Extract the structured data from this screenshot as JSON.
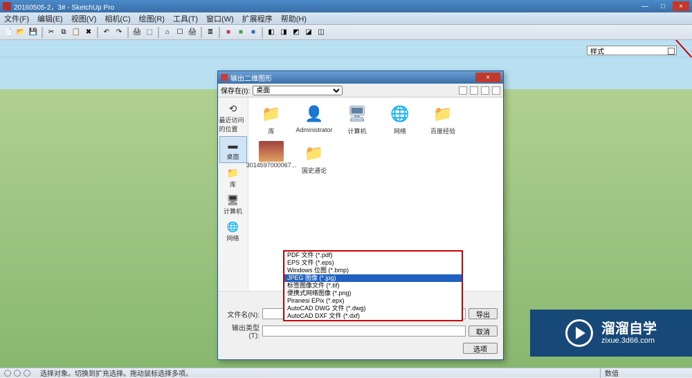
{
  "window": {
    "title": "20160505-2，3# - SketchUp Pro",
    "controls": {
      "min": "—",
      "max": "□",
      "close": "×"
    }
  },
  "menus": [
    "文件(F)",
    "编辑(E)",
    "视图(V)",
    "相机(C)",
    "绘图(R)",
    "工具(T)",
    "窗口(W)",
    "扩展程序",
    "帮助(H)"
  ],
  "toolbar1_icons": [
    "new-icon",
    "open-icon",
    "save-icon",
    "sep",
    "cut-icon",
    "copy-icon",
    "paste-icon",
    "delete-icon",
    "sep",
    "undo-icon",
    "redo-icon",
    "sep",
    "print-icon",
    "model-icon",
    "sep",
    "home-icon",
    "room-icon",
    "print2-icon",
    "sep",
    "layers-icon",
    "sep",
    "rgb1-icon",
    "rgb2-icon",
    "rgb3-icon",
    "sep",
    "ext1-icon",
    "ext2-icon",
    "ext3-icon",
    "ext4-icon",
    "ext5-icon"
  ],
  "toolbar2_icons": [
    "pointer-icon",
    "sep",
    "pencil-icon",
    "line-icon",
    "arc-icon",
    "rect-icon",
    "circle-icon",
    "polygon-icon",
    "sep",
    "pushpull-icon",
    "followme-icon",
    "offset-icon",
    "sep",
    "move-icon",
    "rotate-icon",
    "scale-icon",
    "sep",
    "tape-icon",
    "protractor-icon",
    "text-icon",
    "sep",
    "orbit-icon",
    "pan-icon",
    "zoom-icon",
    "zoomext-icon",
    "sep",
    "iso-icon",
    "top-icon",
    "front-icon",
    "back-icon",
    "left-icon",
    "right-icon",
    "sep",
    "section-icon",
    "sep",
    "tb-s1",
    "tb-s2",
    "tb-s3",
    "tb-s4",
    "tb-s5",
    "tb-s6",
    "tb-s7",
    "tb-s8",
    "tb-s9",
    "tb-s10",
    "tb-s11",
    "tb-s12",
    "tb-s13",
    "tb-s14",
    "tb-s15",
    "tb-s16",
    "tb-s17",
    "tb-s18",
    "tb-su"
  ],
  "style_panel": {
    "label": "样式"
  },
  "status": {
    "hint": "选择对象。切换到扩充选择。拖动鼠标选择多项。",
    "field1": "数值",
    "options": "选项"
  },
  "dialog": {
    "title": "输出二维图形",
    "save_in_label": "保存在(I):",
    "save_in_value": "桌面",
    "sidebar": [
      {
        "icon": "⟲",
        "label": "最近访问的位置"
      },
      {
        "icon": "▬",
        "label": "桌面"
      },
      {
        "icon": "📁",
        "label": "库"
      },
      {
        "icon": "🖥",
        "label": "计算机"
      },
      {
        "icon": "🌐",
        "label": "网络"
      }
    ],
    "files": [
      {
        "icon": "folder",
        "label": "库"
      },
      {
        "icon": "user",
        "label": "Administrator"
      },
      {
        "icon": "monitor",
        "label": "计算机"
      },
      {
        "icon": "globe",
        "label": "网络"
      },
      {
        "icon": "folder",
        "label": "百度经验"
      },
      {
        "icon": "pic",
        "label": "3014597000067..."
      },
      {
        "icon": "folder",
        "label": "国史通论"
      }
    ],
    "filetypes": [
      "PDF 文件 (*.pdf)",
      "EPS 文件 (*.eps)",
      "Windows 位图 (*.bmp)",
      "JPEG 图像 (*.jpg)",
      "标签图像文件 (*.tif)",
      "便携式网络图像 (*.png)",
      "Piranesi EPix (*.epx)",
      "AutoCAD DWG 文件 (*.dwg)",
      "AutoCAD DXF 文件 (*.dxf)"
    ],
    "filetype_sel_index": 3,
    "filename_label": "文件名(N):",
    "filetype_label": "输出类型(T):",
    "export_btn": "导出",
    "cancel_btn": "取消"
  },
  "watermark": {
    "brand": "溜溜自学",
    "url": "zixue.3d66.com"
  }
}
